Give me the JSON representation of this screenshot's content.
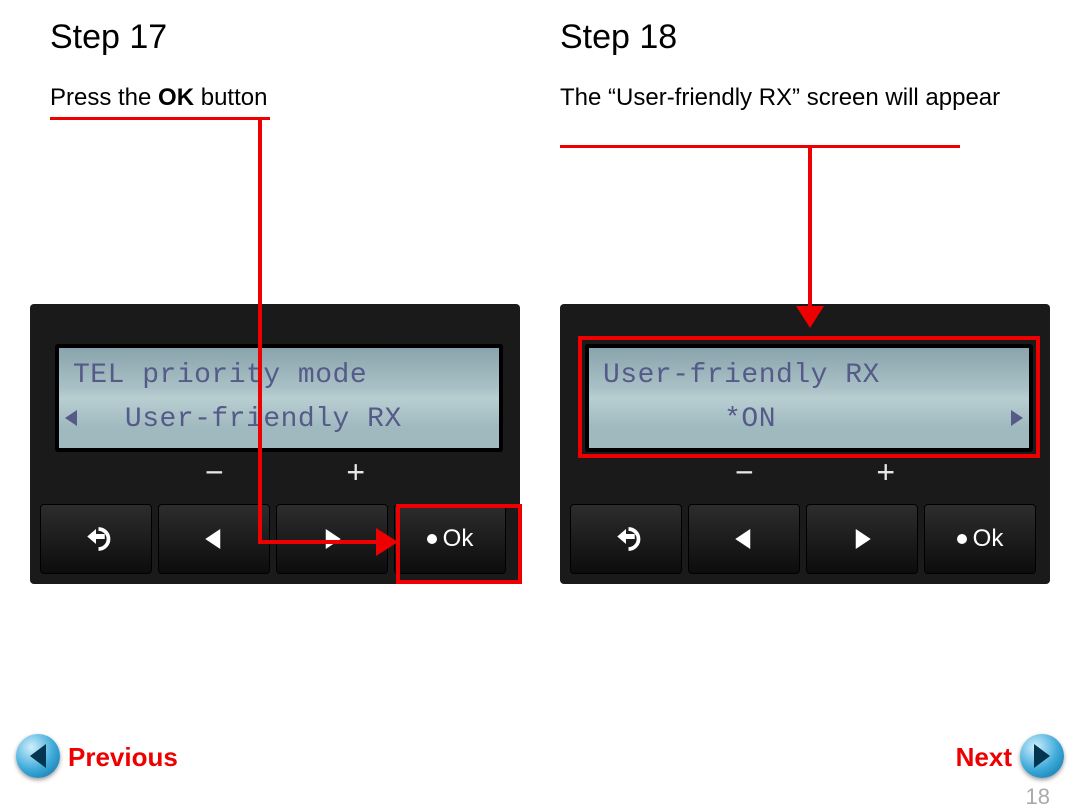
{
  "left": {
    "heading": "Step 17",
    "instr_pre": "Press the ",
    "instr_bold": "OK",
    "instr_post": " button",
    "lcd_line1": "TEL priority mode",
    "lcd_line2": "   User-friendly RX",
    "ok_label": "Ok",
    "minus": "−",
    "plus": "+"
  },
  "right": {
    "heading": "Step 18",
    "instr": "The “User-friendly RX” screen will appear",
    "lcd_line1": "User-friendly RX",
    "lcd_line2": "       *ON",
    "ok_label": "Ok",
    "minus": "−",
    "plus": "+"
  },
  "nav": {
    "prev": "Previous",
    "next": "Next"
  },
  "page_number": "18"
}
